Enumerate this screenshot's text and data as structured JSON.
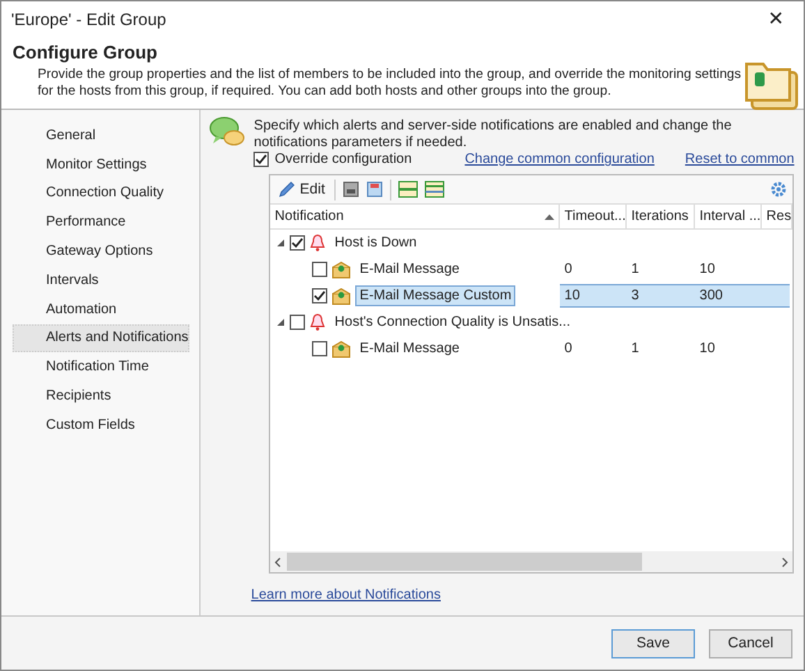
{
  "window": {
    "title": "'Europe' - Edit Group",
    "close": "✕"
  },
  "header": {
    "title": "Configure Group",
    "description": "Provide the group properties and the list of members to be included into the group, and override the monitoring settings for the hosts from this group, if required. You can add both hosts and other groups into the group."
  },
  "sidebar": {
    "items": [
      {
        "label": "General",
        "selected": false
      },
      {
        "label": "Monitor Settings",
        "selected": false
      },
      {
        "label": "Connection Quality",
        "selected": false
      },
      {
        "label": "Performance",
        "selected": false
      },
      {
        "label": "Gateway Options",
        "selected": false
      },
      {
        "label": "Intervals",
        "selected": false
      },
      {
        "label": "Automation",
        "selected": false
      },
      {
        "label": "Alerts and Notifications",
        "selected": true
      },
      {
        "label": "Notification Time",
        "selected": false
      },
      {
        "label": "Recipients",
        "selected": false
      },
      {
        "label": "Custom Fields",
        "selected": false
      }
    ]
  },
  "intro": "Specify which alerts and server-side notifications are enabled and change the notifications parameters if needed.",
  "override": {
    "label": "Override configuration",
    "checked": true
  },
  "links": [
    "Change common configuration",
    "Reset to common"
  ],
  "toolbar": {
    "edit": "Edit"
  },
  "table": {
    "columns": [
      "Notification",
      "Timeout...",
      "Iterations",
      "Interval ...",
      "Res"
    ],
    "rows": [
      {
        "kind": "alert",
        "name": "Host is Down",
        "checked": true,
        "expanded": true,
        "selected": false,
        "cells": [],
        "children": [
          {
            "kind": "action",
            "name": "E-Mail Message",
            "checked": false,
            "selected": false,
            "cells": [
              "0",
              "1",
              "10"
            ]
          },
          {
            "kind": "action",
            "name": "E-Mail Message Custom",
            "checked": true,
            "selected": true,
            "cells": [
              "10",
              "3",
              "300"
            ]
          }
        ]
      },
      {
        "kind": "alert",
        "name": "Host's Connection Quality is Unsatis...",
        "checked": false,
        "expanded": true,
        "selected": false,
        "cells": [],
        "children": [
          {
            "kind": "action",
            "name": "E-Mail Message",
            "checked": false,
            "selected": false,
            "cells": [
              "0",
              "1",
              "10"
            ]
          }
        ]
      }
    ]
  },
  "learn_more": "Learn more about Notifications",
  "buttons": [
    {
      "label": "Save",
      "default": true
    },
    {
      "label": "Cancel",
      "default": false
    }
  ]
}
